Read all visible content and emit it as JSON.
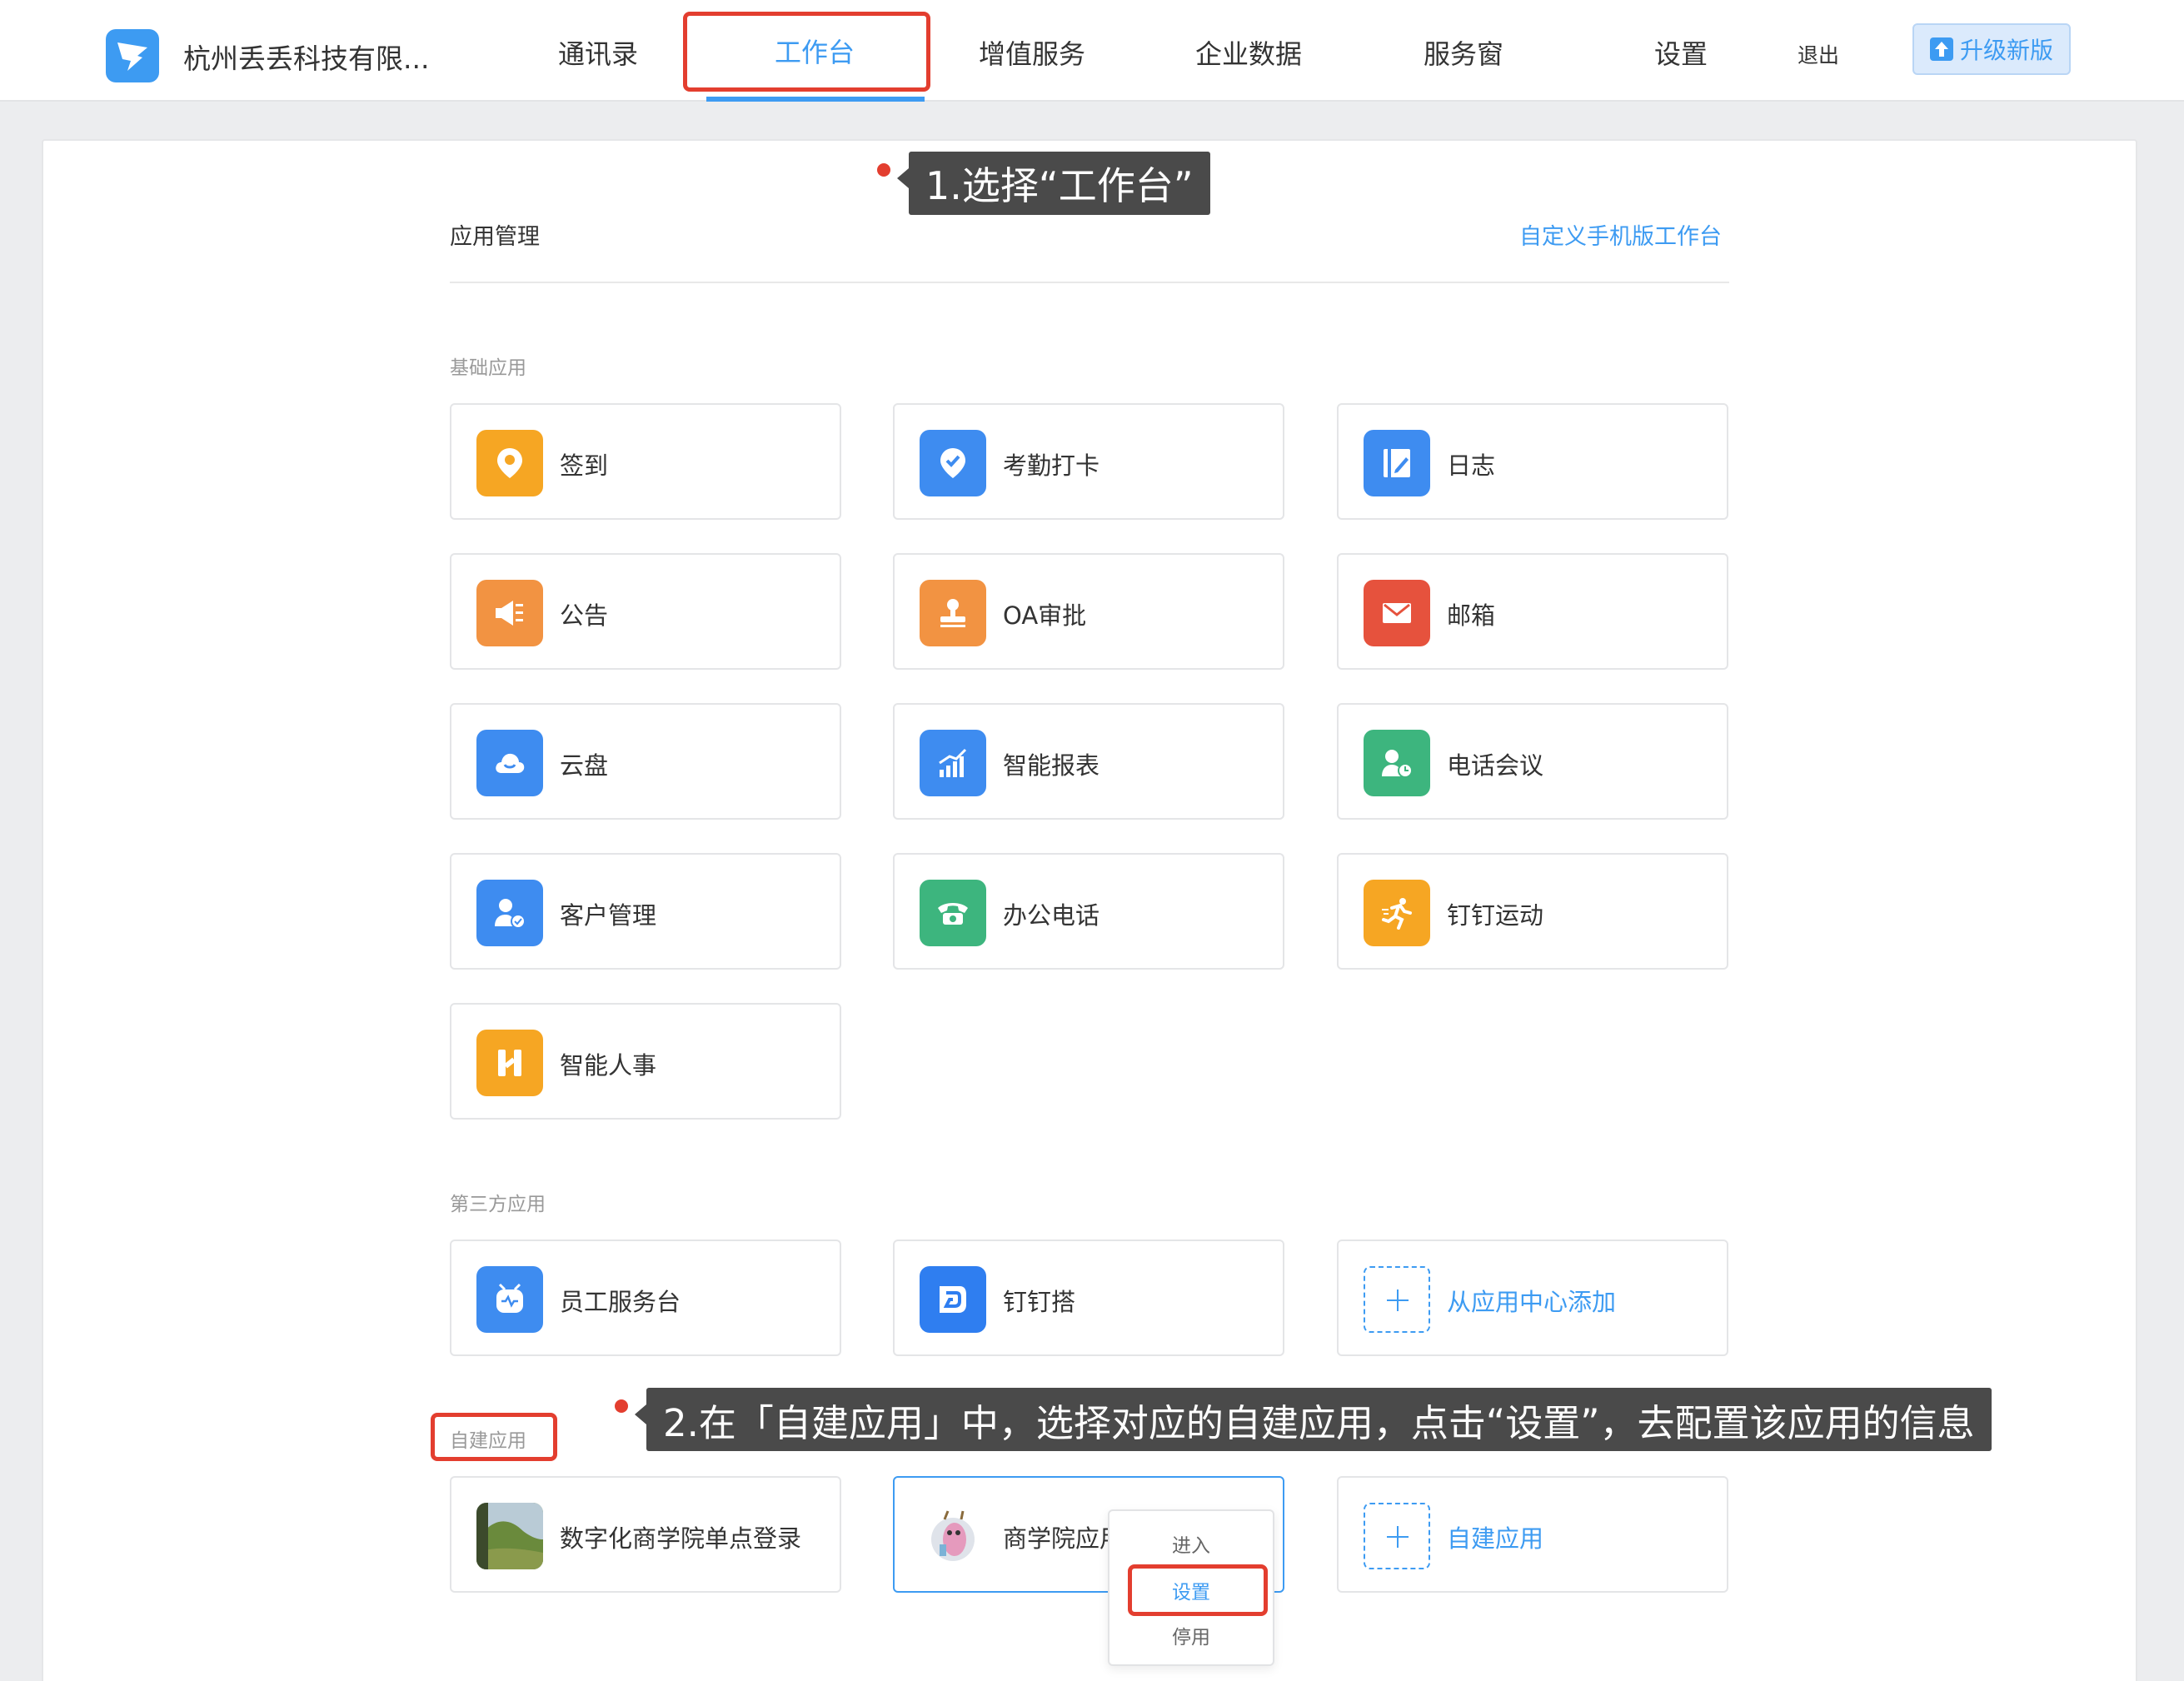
{
  "header": {
    "org_name": "杭州丢丢科技有限...",
    "nav": [
      "通讯录",
      "工作台",
      "增值服务",
      "企业数据",
      "服务窗",
      "设置"
    ],
    "logout": "退出",
    "upgrade": "升级新版"
  },
  "workspace": {
    "title": "应用管理",
    "custom_link": "自定义手机版工作台"
  },
  "groups": {
    "basic": {
      "label": "基础应用",
      "apps": [
        {
          "label": "签到",
          "icon": "location-pin-icon",
          "color": "#f6a623"
        },
        {
          "label": "考勤打卡",
          "icon": "check-pin-icon",
          "color": "#3e8cf0"
        },
        {
          "label": "日志",
          "icon": "log-book-icon",
          "color": "#3e8cf0"
        },
        {
          "label": "公告",
          "icon": "megaphone-icon",
          "color": "#f29342"
        },
        {
          "label": "OA审批",
          "icon": "stamp-icon",
          "color": "#f29342"
        },
        {
          "label": "邮箱",
          "icon": "mail-icon",
          "color": "#e6523d"
        },
        {
          "label": "云盘",
          "icon": "cloud-icon",
          "color": "#3e8cf0"
        },
        {
          "label": "智能报表",
          "icon": "bar-chart-icon",
          "color": "#3e8cf0"
        },
        {
          "label": "电话会议",
          "icon": "conference-call-icon",
          "color": "#3db57e"
        },
        {
          "label": "客户管理",
          "icon": "customer-icon",
          "color": "#3e8cf0"
        },
        {
          "label": "办公电话",
          "icon": "phone-icon",
          "color": "#3db57e"
        },
        {
          "label": "钉钉运动",
          "icon": "runner-icon",
          "color": "#f6a623"
        },
        {
          "label": "智能人事",
          "icon": "hr-icon",
          "color": "#f6a623"
        }
      ]
    },
    "third_party": {
      "label": "第三方应用",
      "apps": [
        {
          "label": "员工服务台",
          "icon": "robot-icon",
          "color": "#3e8cf0"
        },
        {
          "label": "钉钉搭",
          "icon": "dingda-icon",
          "color": "#2f7ef0"
        }
      ],
      "add_label": "从应用中心添加"
    },
    "custom": {
      "label": "自建应用",
      "apps": [
        {
          "label": "数字化商学院单点登录",
          "icon": "landscape-photo-icon"
        },
        {
          "label": "商学院应用",
          "icon": "cartoon-avatar-icon"
        }
      ],
      "add_label": "自建应用"
    }
  },
  "context_menu": [
    "进入",
    "设置",
    "停用"
  ],
  "annotations": {
    "step1": "1.选择“工作台”",
    "step2": "2.在「自建应用」中，选择对应的自建应用，点击“设置”，去配置该应用的信息"
  },
  "colors": {
    "accent": "#3d9bf2",
    "annotation_red": "#e33e2f",
    "callout_bg": "#4a4a4a"
  }
}
